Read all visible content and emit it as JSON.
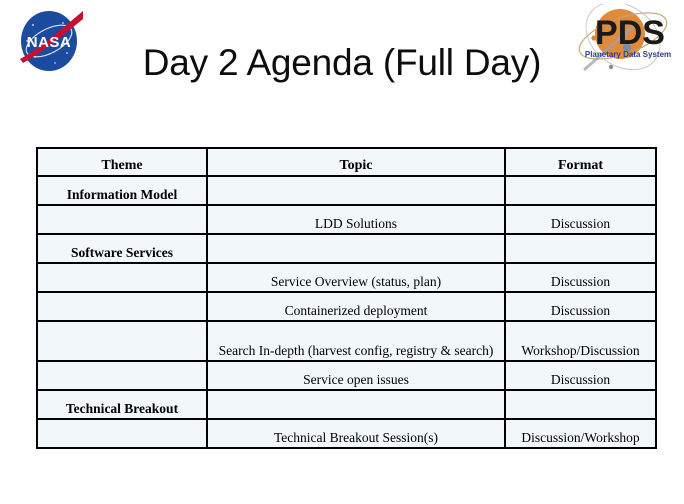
{
  "header": {
    "title": "Day 2 Agenda (Full Day)",
    "nasa_logo": {
      "name": "nasa-meatball-logo",
      "wordmark": "NASA",
      "circle_color": "#1b4b9e",
      "swoosh_color": "#c8102e",
      "text_color": "#ffffff"
    },
    "pds_logo": {
      "name": "pds-logo",
      "acronym": "PDS",
      "tagline": "Planetary Data System",
      "planet_color": "#e08a3c",
      "acronym_color": "#1a1a1a",
      "tagline_color": "#2d3d8f",
      "moon_color": "#7d8ca3"
    }
  },
  "table": {
    "columns": [
      "Theme",
      "Topic",
      "Format"
    ],
    "rows": [
      {
        "theme": "Information Model",
        "topic": "",
        "format": ""
      },
      {
        "theme": "",
        "topic": "LDD Solutions",
        "format": "Discussion"
      },
      {
        "theme": "Software Services",
        "topic": "",
        "format": ""
      },
      {
        "theme": "",
        "topic": "Service Overview (status, plan)",
        "format": "Discussion"
      },
      {
        "theme": "",
        "topic": "Containerized deployment",
        "format": "Discussion"
      },
      {
        "theme": "",
        "topic": "Search In-depth (harvest config, registry & search)",
        "format": "Workshop/Discussion"
      },
      {
        "theme": "",
        "topic": "Service open issues",
        "format": "Discussion"
      },
      {
        "theme": "Technical Breakout",
        "topic": "",
        "format": ""
      },
      {
        "theme": "",
        "topic": "Technical Breakout Session(s)",
        "format": "Discussion/Workshop"
      }
    ]
  },
  "colors": {
    "cell_background": "#f2f7fa",
    "border": "#000000",
    "page_background": "#ffffff",
    "title_color": "#0d0d0d"
  }
}
